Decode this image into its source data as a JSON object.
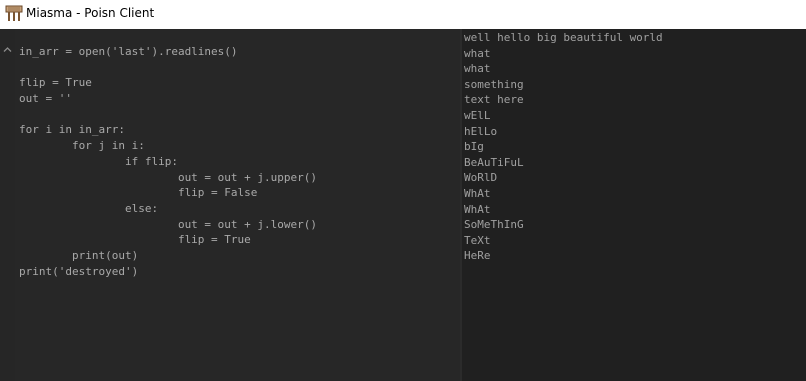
{
  "window": {
    "title": "Miasma - Poisn Client",
    "icon": "wooden-sign-icon"
  },
  "editor": {
    "scroll_icon": "chevron-up-icon",
    "lines": [
      "in_arr = open('last').readlines()",
      "",
      "flip = True",
      "out = ''",
      "",
      "for i in in_arr:",
      "        for j in i:",
      "                if flip:",
      "                        out = out + j.upper()",
      "                        flip = False",
      "                else:",
      "                        out = out + j.lower()",
      "                        flip = True",
      "        print(out)",
      "print('destroyed')"
    ]
  },
  "output": {
    "lines": [
      "well hello big beautiful world",
      "what",
      "what",
      "something",
      "text here",
      "wElL",
      "hElLo",
      "bIg",
      "BeAuTiFuL",
      "WoRlD",
      "WhAt",
      "WhAt",
      "SoMeThInG",
      "TeXt",
      "HeRe"
    ]
  },
  "colors": {
    "editor_bg": "#272727",
    "output_bg": "#202020",
    "code_text": "#a9a9a9",
    "output_text": "#a0a0a0",
    "titlebar_bg": "#ffffff"
  }
}
